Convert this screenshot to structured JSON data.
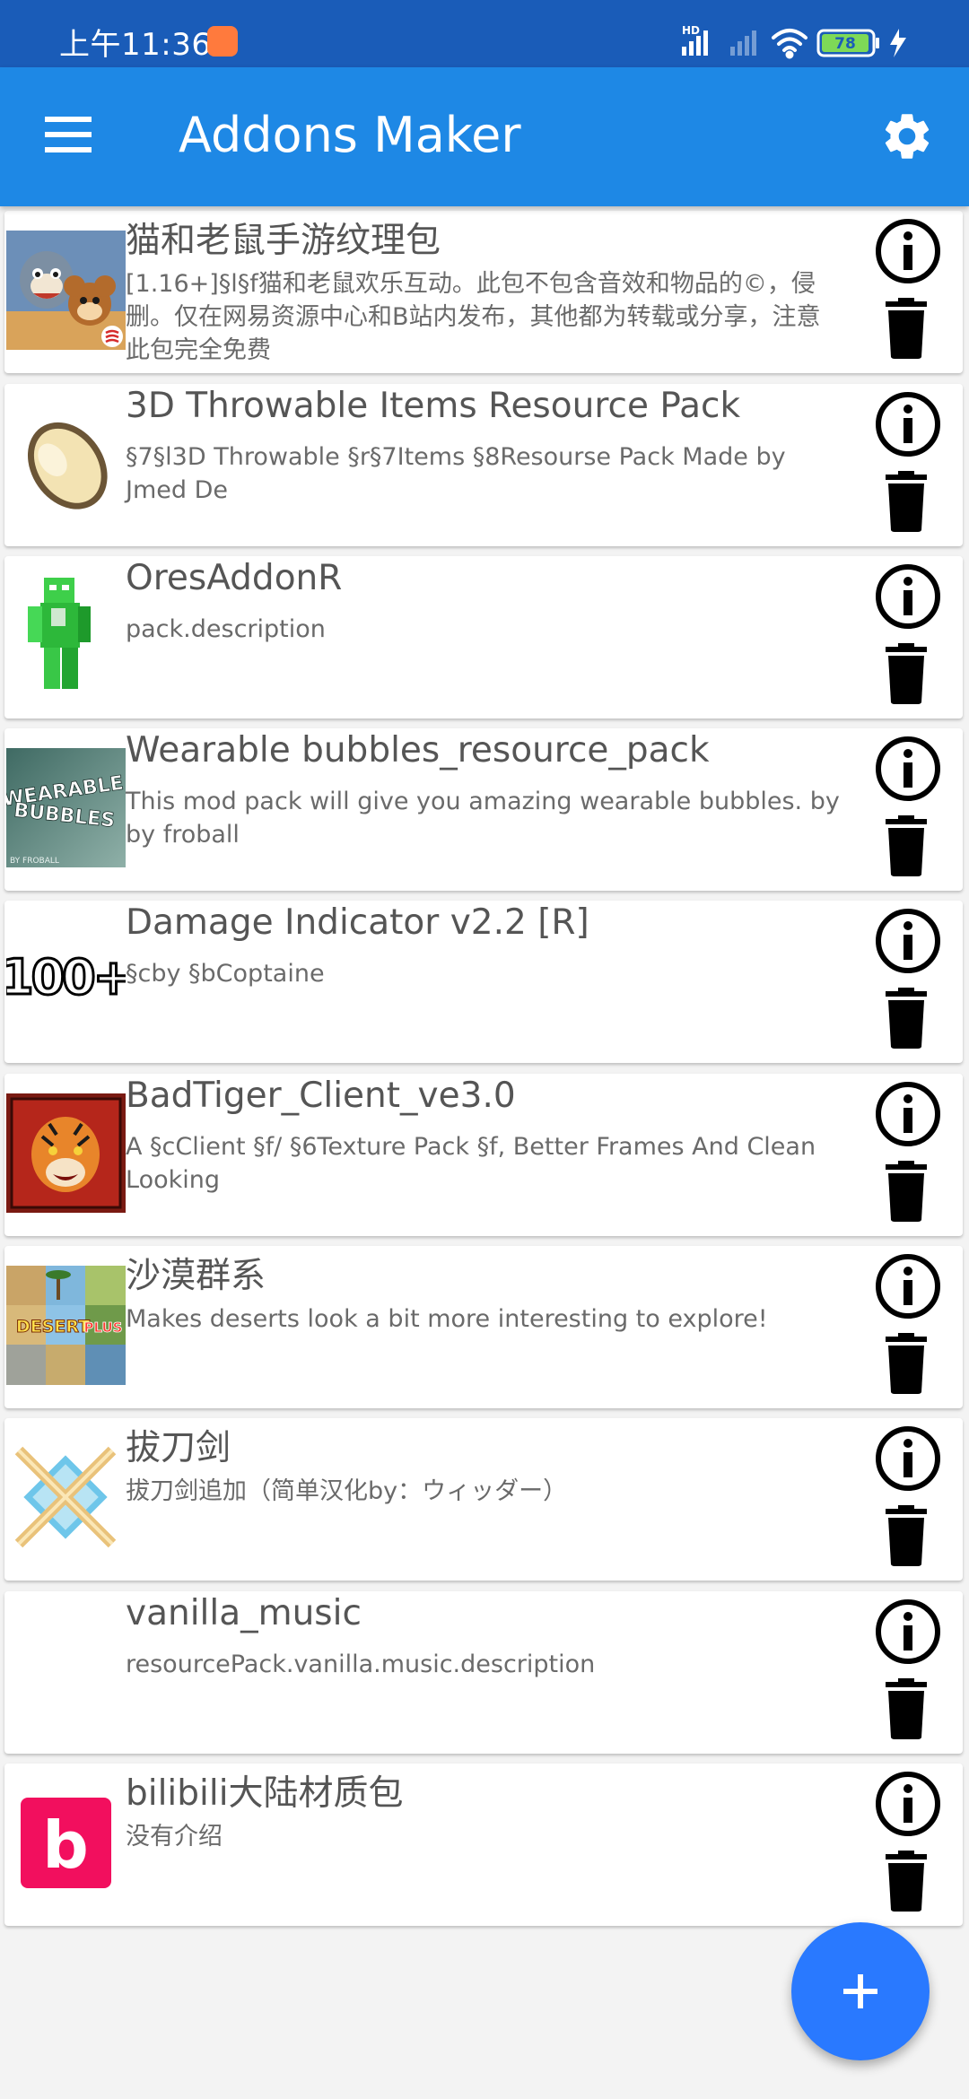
{
  "status_bar": {
    "time": "上午11:36",
    "network_label": "HD",
    "battery": "78",
    "icons": [
      "app-notification-icon",
      "signal-icon",
      "signal-empty-icon",
      "wifi-icon",
      "battery-icon",
      "charging-icon"
    ]
  },
  "app_bar": {
    "title": "Addons Maker",
    "icons": [
      "menu-icon",
      "settings-icon"
    ]
  },
  "packs": [
    {
      "title": "猫和老鼠手游纹理包",
      "description": "[1.16+]§l§f猫和老鼠欢乐互动。此包不包含音效和物品的©，侵删。仅在网易资源中心和B站内发布，其他都为转载或分享，注意此包完全免费",
      "thumbnail": "tom-and-jerry-thumbnail"
    },
    {
      "title": "3D Throwable Items Resource Pack",
      "description": "§7§l3D Throwable §r§7Items §8Resourse Pack Made by Jmed De",
      "thumbnail": "egg-item-thumbnail"
    },
    {
      "title": "OresAddonR",
      "description": "pack.description",
      "thumbnail": "green-ore-character-thumbnail"
    },
    {
      "title": "Wearable bubbles_resource_pack",
      "description": "This mod pack will give you amazing wearable bubbles. by by froball",
      "thumbnail": "wearable-bubbles-thumbnail",
      "thumb_text_1": "WEARABLE",
      "thumb_text_2": "BUBBLES",
      "thumb_caption": "BY FROBALL"
    },
    {
      "title": "Damage Indicator v2.2 [R]",
      "description": "§cby §bCoptaine",
      "thumbnail": "damage-number-thumbnail",
      "thumb_text_1": "100+"
    },
    {
      "title": "BadTiger_Client_ve3.0",
      "description": "A §cClient §f/ §6Texture Pack §f, Better Frames And Clean Looking",
      "thumbnail": "tiger-logo-thumbnail"
    },
    {
      "title": "沙漠群系",
      "description": "Makes deserts look a bit more interesting to explore!",
      "thumbnail": "desert-plus-thumbnail",
      "thumb_text_1": "DESERT",
      "thumb_text_2": "PLUS"
    },
    {
      "title": "拔刀剑",
      "description": "拔刀剑追加（简单汉化by：ウィッダー）",
      "thumbnail": "crossed-swords-thumbnail"
    },
    {
      "title": "vanilla_music",
      "description": "resourcePack.vanilla.music.description",
      "thumbnail": "blank-thumbnail"
    },
    {
      "title": "bilibili大陆材质包",
      "description": "没有介绍",
      "thumbnail": "bilibili-logo-thumbnail",
      "thumb_text_1": "b"
    }
  ],
  "row_actions": {
    "info_icon": "info-icon",
    "delete_icon": "trash-icon"
  },
  "fab": {
    "label": "+",
    "icon": "add-icon"
  },
  "colors": {
    "status_bar": "#1a5cb8",
    "app_bar": "#1e88e5",
    "fab": "#2979ff",
    "background": "#f3f3f3",
    "card": "#ffffff",
    "title_text": "#555555",
    "description_text": "#6a6a6a",
    "battery_fill": "#7ed957"
  }
}
